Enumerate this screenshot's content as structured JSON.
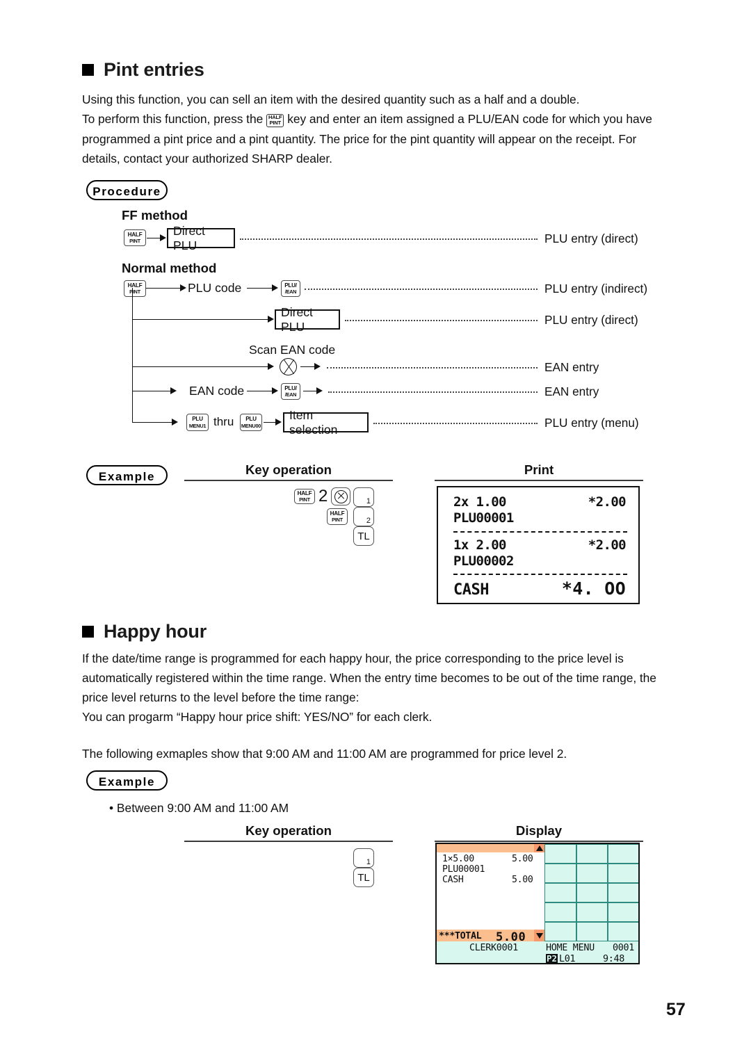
{
  "page": {
    "number": "57"
  },
  "section1": {
    "title": "Pint entries",
    "paragraph_lines": [
      "Using this function, you can sell an item with the desired quantity such as a half and a double.",
      "To perform this function, press the ",
      " key and enter an item assigned a PLU/EAN code for which you have",
      "programmed a pint price and a pint quantity. The price for the pint quantity will appear on the receipt. For",
      "details, contact your authorized SHARP dealer."
    ],
    "inline_key": {
      "line1": "HALF",
      "line2": "PINT"
    },
    "procedure_label": "Procedure",
    "ff_method_title": "FF method",
    "normal_method_title": "Normal method",
    "flow": {
      "halfpint_key": {
        "line1": "HALF",
        "line2": "PINT"
      },
      "plu_ean_key": {
        "line1": "PLU/",
        "line2": "/EAN"
      },
      "plu_menu1_key": {
        "line1": "PLU",
        "line2": "MENU1"
      },
      "plu_menu00_key": {
        "line1": "PLU",
        "line2": "MENU00"
      },
      "direct_plu_box_1": "Direct PLU",
      "direct_plu_box_2": "Direct PLU",
      "plu_code_text": "PLU code",
      "scan_ean_text": "Scan EAN code",
      "ean_code_text": "EAN code",
      "thru_text": "thru",
      "item_selection_box": "Item selection",
      "result_ff": "PLU entry (direct)",
      "result_indirect": "PLU entry (indirect)",
      "result_direct": "PLU entry (direct)",
      "result_ean_scan": "EAN entry",
      "result_ean_code": "EAN entry",
      "result_menu": "PLU entry (menu)"
    },
    "example_label": "Example",
    "key_operation_header": "Key operation",
    "print_header": "Print",
    "key_operation": {
      "halfpint": {
        "line1": "HALF",
        "line2": "PINT"
      },
      "qty": "2",
      "multiply_icon": "multiply-circle-icon",
      "key_1": "1",
      "halfpint2": {
        "line1": "HALF",
        "line2": "PINT"
      },
      "key_2": "2",
      "key_tl": "TL"
    },
    "receipt": {
      "line1_left": "2x 1.00",
      "line1_right": "*2.00",
      "line2": "PLU00001",
      "line3_left": "1x 2.00",
      "line3_right": "*2.00",
      "line4": "PLU00002",
      "total_label": "CASH",
      "total_value": "*4. OO"
    }
  },
  "section2": {
    "title": "Happy hour",
    "paragraph_lines": [
      "If the date/time range is programmed for each happy hour, the price corresponding to the price level is",
      "automatically registered within the time range. When the entry time becomes to be out of the time range, the",
      "price level returns to the level before the time range:",
      "You can progarm “Happy hour price shift: YES/NO” for each clerk."
    ],
    "note_line": "The following exmaples show that 9:00 AM and 11:00 AM are programmed for price level 2.",
    "example_label": "Example",
    "bullet_text": "• Between 9:00 AM and 11:00 AM",
    "key_operation_header": "Key operation",
    "display_header": "Display",
    "key_operation": {
      "key_1": "1",
      "key_tl": "TL"
    },
    "display": {
      "scroll_up_icon": "scroll-up-arrow-icon",
      "scroll_down_icon": "scroll-down-arrow-icon",
      "lines": [
        {
          "left": "1×5.00",
          "right": "5.00"
        },
        {
          "left": "PLU00001",
          "right": ""
        },
        {
          "left": "CASH",
          "right": "5.00"
        }
      ],
      "total_label": "***TOTAL",
      "total_value": "5.00",
      "status_clerk": "CLERK0001",
      "status_menu": "HOME MENU",
      "status_counter": "0001",
      "status_badge": "P2",
      "status_level": "L01",
      "status_time": "9:48",
      "colors": {
        "bar": "#fbbe8f",
        "panel_bg": "#d7f7ef",
        "key_border": "#2e8b7f"
      }
    }
  }
}
